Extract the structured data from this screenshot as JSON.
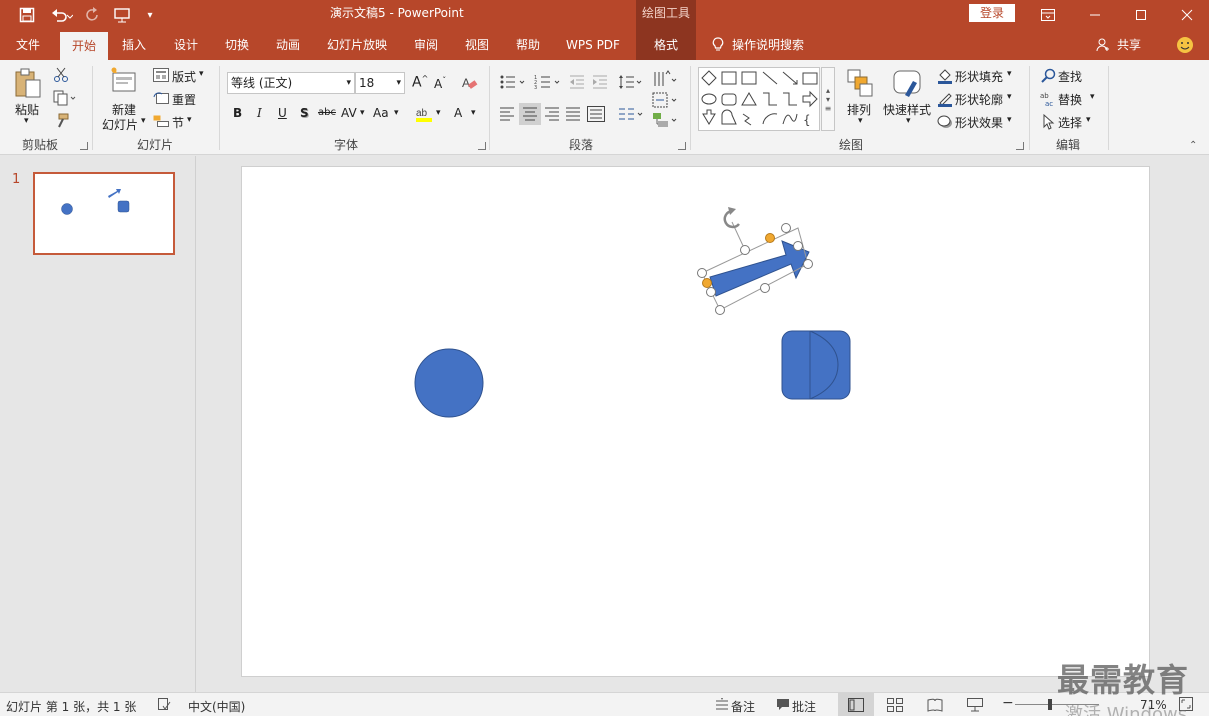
{
  "titlebar": {
    "doc_title": "演示文稿5  -  PowerPoint",
    "context_tab": "绘图工具",
    "login": "登录",
    "colors": {
      "accent": "#b7472a",
      "context": "#8d3520"
    }
  },
  "tabs": [
    "文件",
    "开始",
    "插入",
    "设计",
    "切换",
    "动画",
    "幻灯片放映",
    "审阅",
    "视图",
    "帮助",
    "WPS PDF",
    "格式"
  ],
  "tell_me": "操作说明搜索",
  "share": "共享",
  "ribbon": {
    "clipboard": {
      "paste": "粘贴",
      "label": "剪贴板"
    },
    "slides": {
      "new_slide_line1": "新建",
      "new_slide_line2": "幻灯片",
      "layout": "版式",
      "reset": "重置",
      "section": "节",
      "label": "幻灯片"
    },
    "font": {
      "font_name": "等线 (正文)",
      "font_size": "18",
      "label": "字体",
      "buttons": [
        "B",
        "I",
        "U",
        "S",
        "abc",
        "AV",
        "Aa",
        "A"
      ]
    },
    "paragraph": {
      "label": "段落"
    },
    "drawing": {
      "arrange": "排列",
      "quick_styles": "快速样式",
      "shape_fill": "形状填充",
      "shape_outline": "形状轮廓",
      "shape_effects": "形状效果",
      "label": "绘图"
    },
    "editing": {
      "find": "查找",
      "replace": "替换",
      "select": "选择",
      "label": "编辑"
    }
  },
  "slides_pane": {
    "slide_number": "1"
  },
  "statusbar": {
    "slide_info": "幻灯片 第 1 张，共 1 张",
    "language": "中文(中国)",
    "notes": "备注",
    "comments": "批注",
    "zoom": "71%"
  },
  "watermark": "最需教育",
  "activate_windows": "激活 Windows",
  "shape_color": "#4472c4"
}
